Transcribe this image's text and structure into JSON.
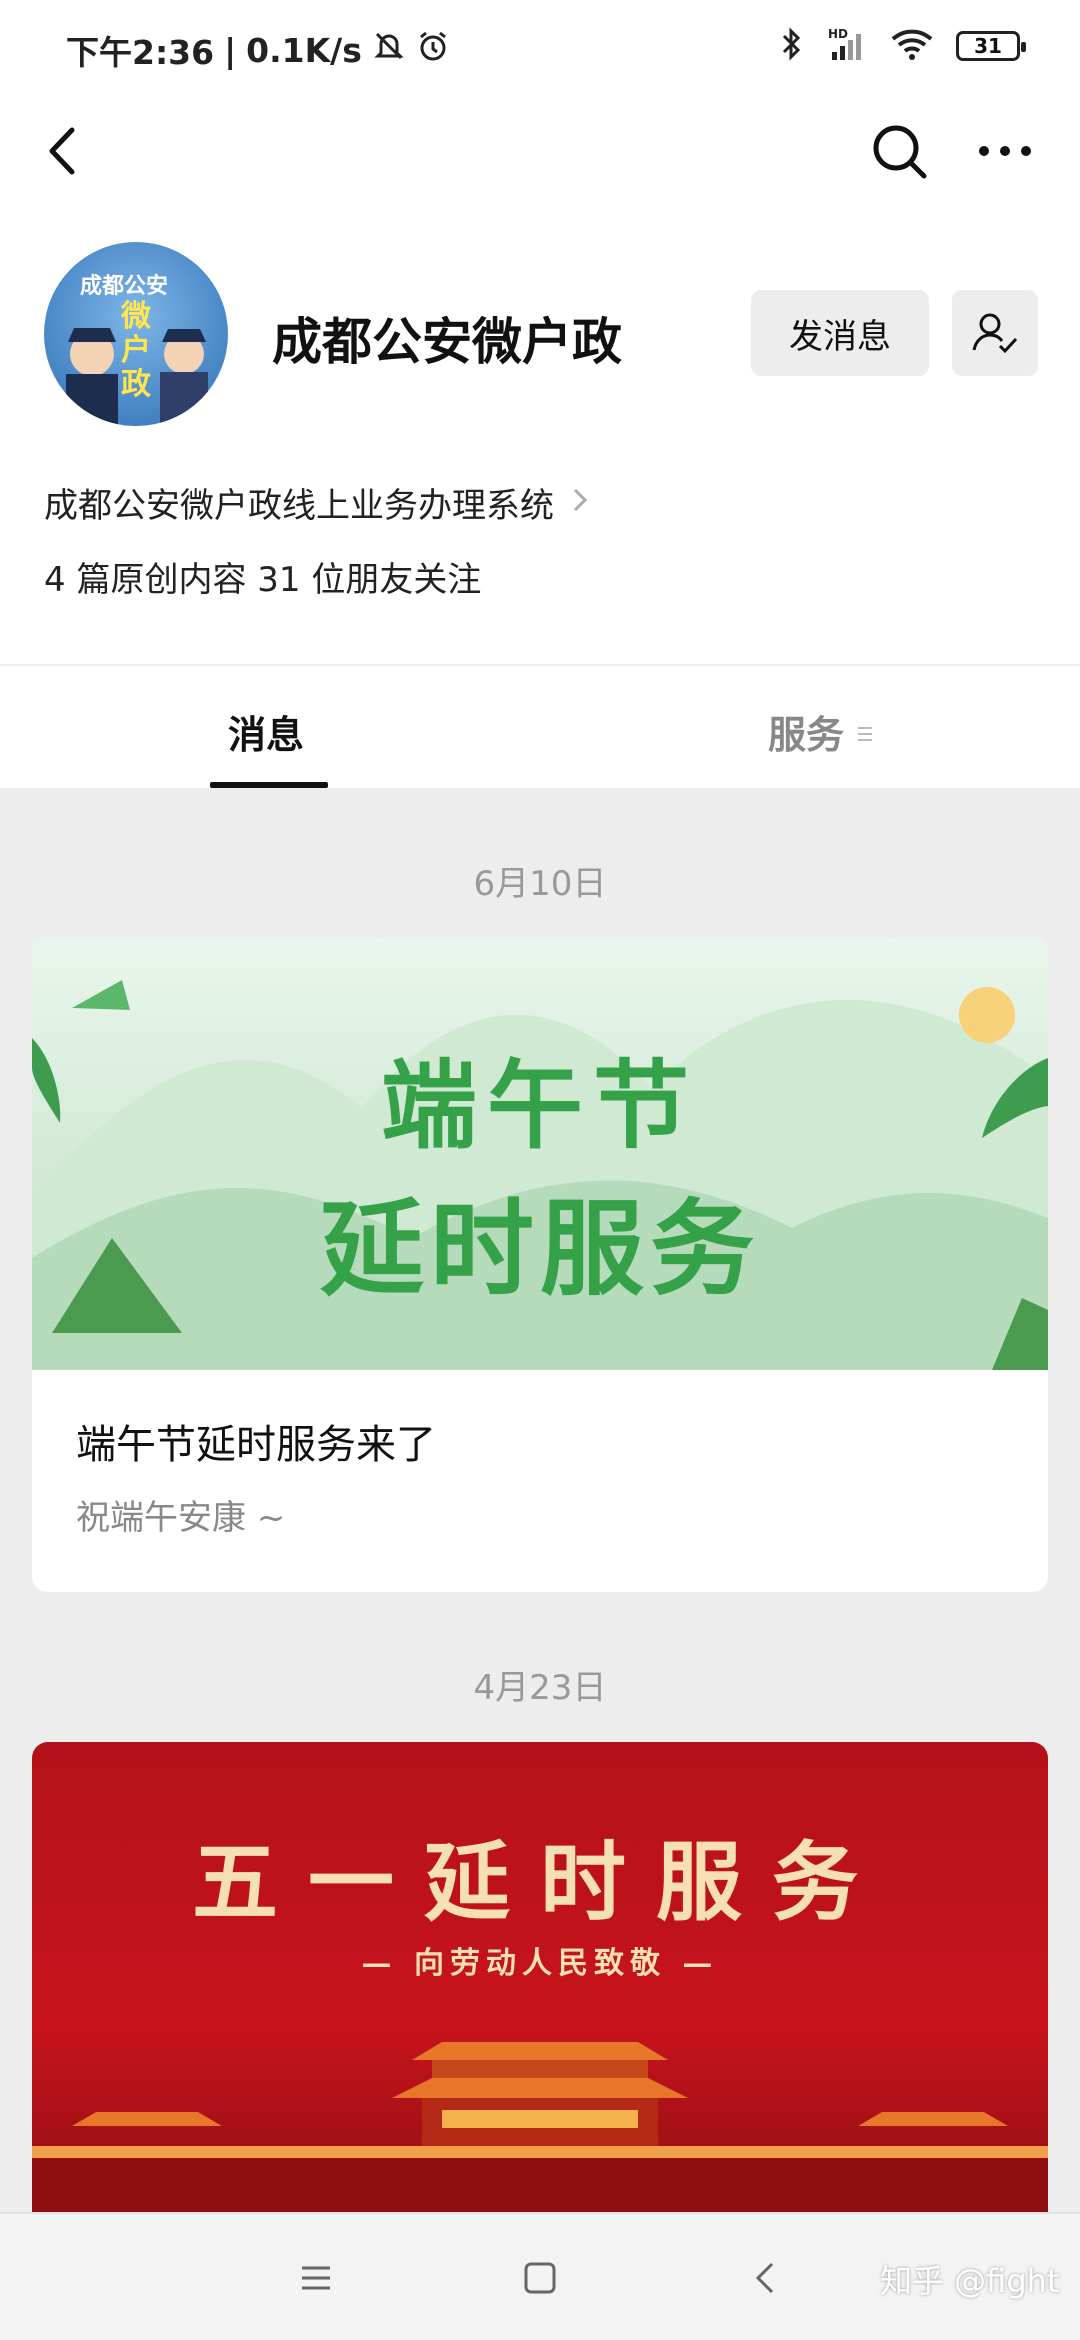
{
  "status_bar": {
    "time": "下午2:36",
    "speed": "0.1K/s",
    "battery": "31",
    "icons": [
      "silent-icon",
      "alarm-icon",
      "bluetooth-icon",
      "signal-hd-icon",
      "wifi-icon",
      "battery-icon"
    ]
  },
  "nav": {
    "icons": [
      "back-icon",
      "search-icon",
      "more-icon"
    ]
  },
  "profile": {
    "name": "成都公安微户政",
    "avatar_text_top": "成都公安",
    "avatar_text_main": "微户政",
    "send_message": "发消息",
    "description": "成都公安微户政线上业务办理系统",
    "stats": "4 篇原创内容  31 位朋友关注"
  },
  "tabs": {
    "messages": "消息",
    "services": "服务"
  },
  "feed": [
    {
      "date": "6月10日",
      "banner_line1": "端午节",
      "banner_line2": "延时服务",
      "title": "端午节延时服务来了",
      "subtitle": "祝端午安康 ~"
    },
    {
      "date": "4月23日",
      "banner_title": "五一延时服务",
      "banner_sub": "— 向劳动人民致敬 —"
    }
  ],
  "watermark": "知乎 @fight",
  "colors": {
    "accent_green": "#35a24a",
    "banner_red": "#c8131c",
    "banner_gold": "#f6dfb2"
  }
}
